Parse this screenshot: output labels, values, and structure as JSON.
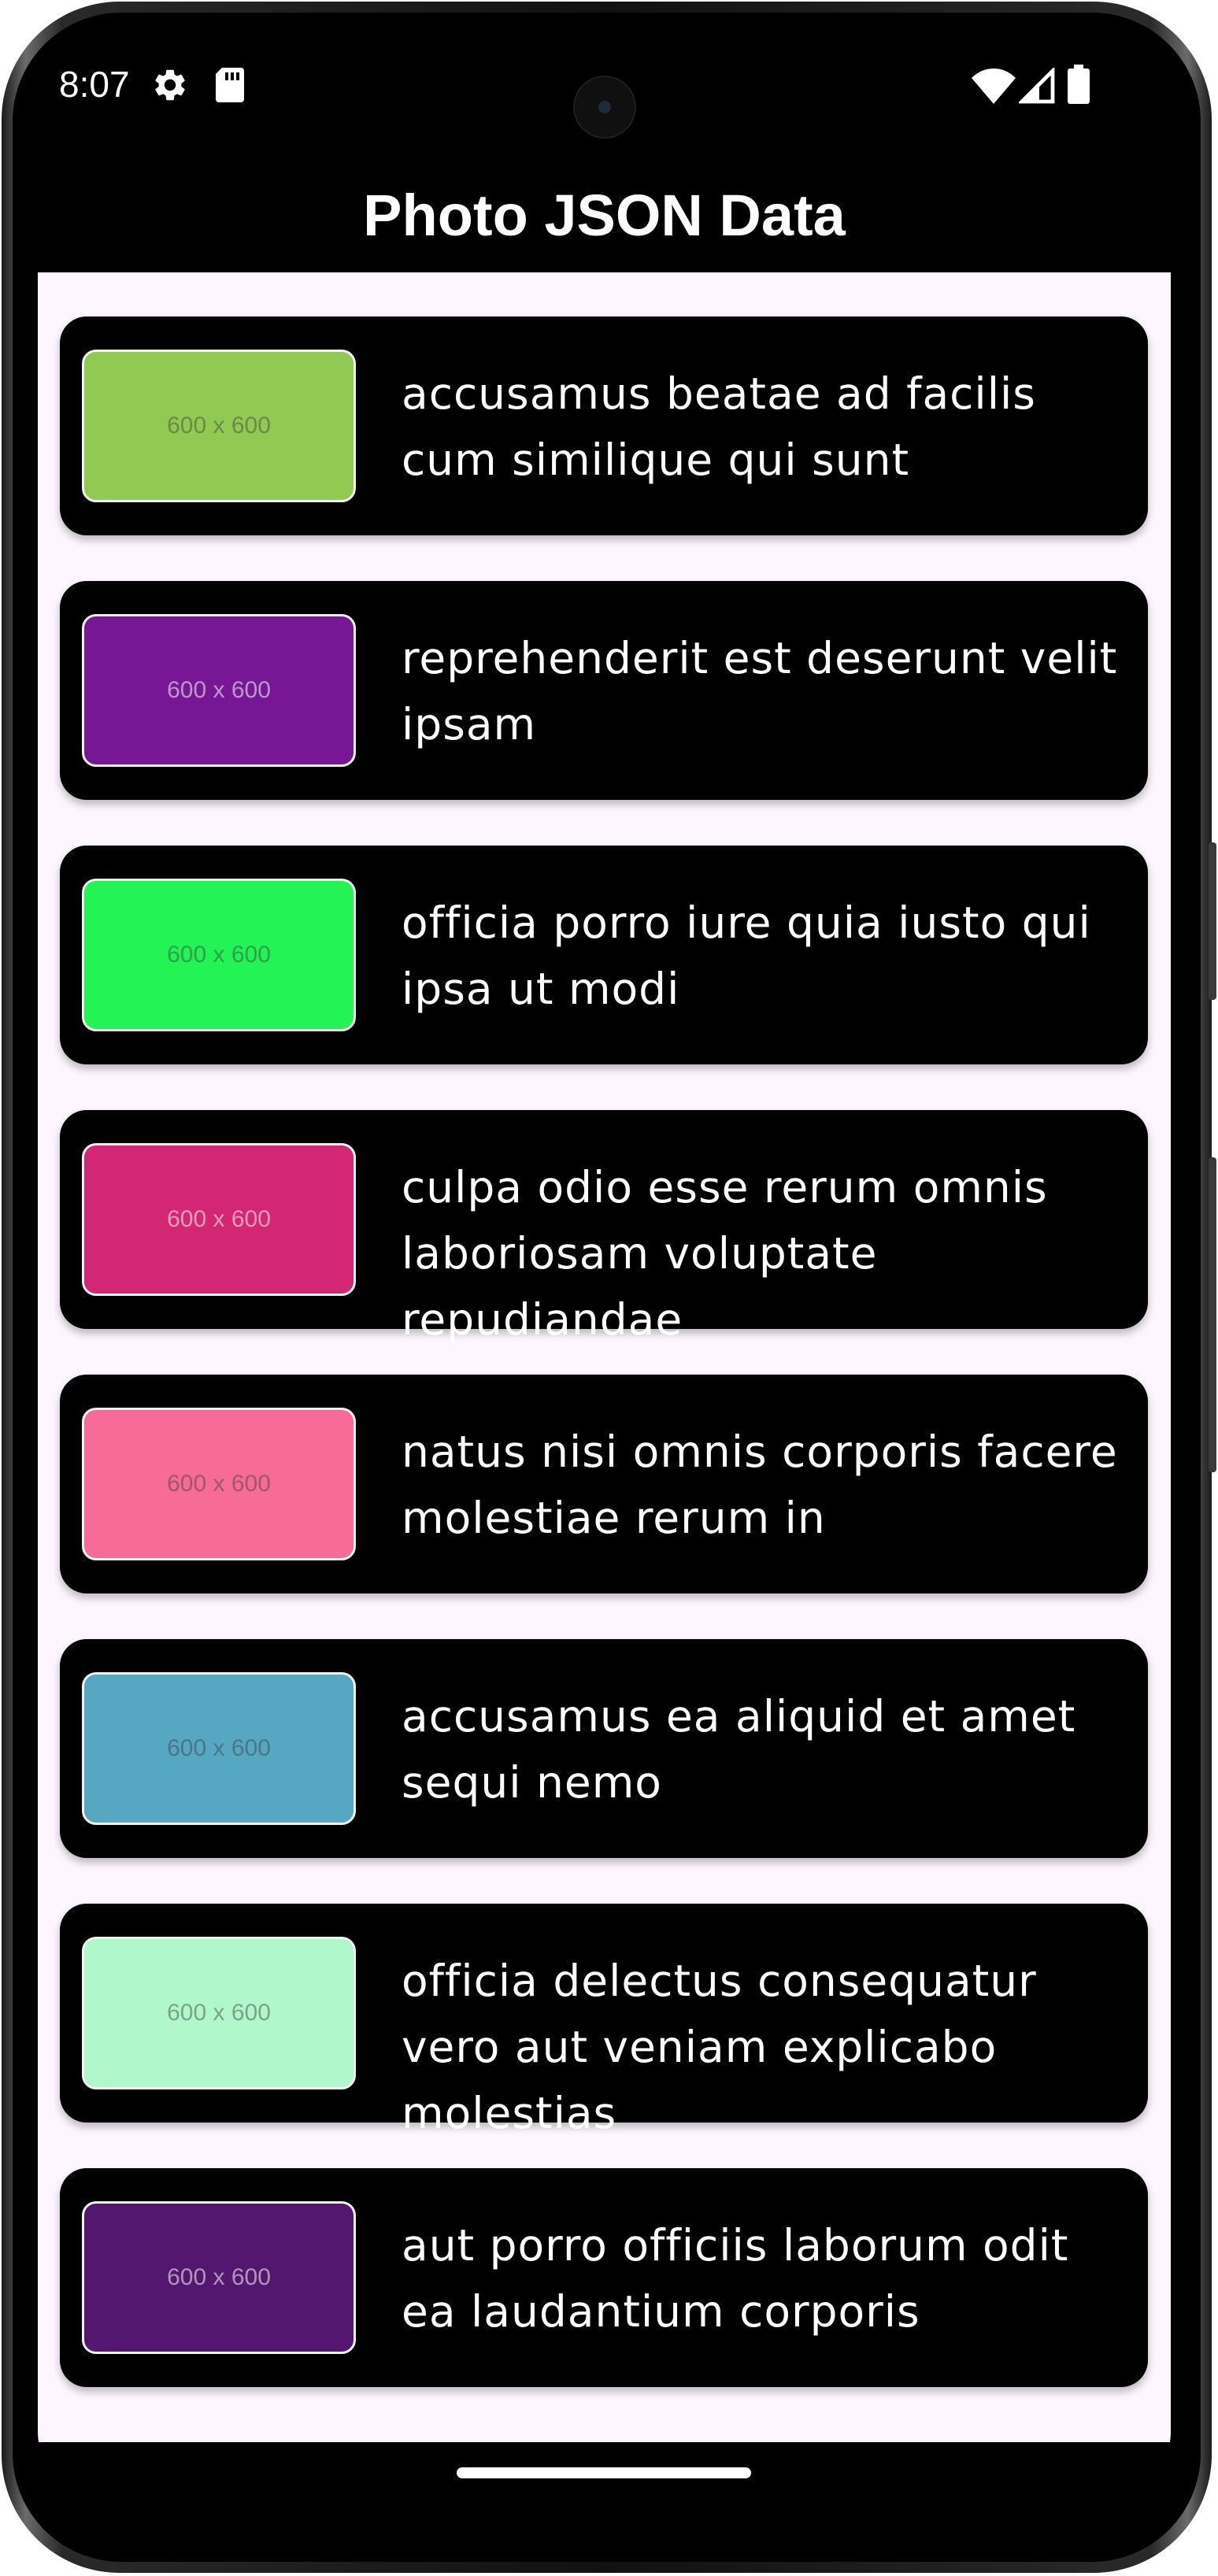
{
  "status_bar": {
    "time": "8:07",
    "left_icons": [
      "gear-icon",
      "sd-card-icon"
    ],
    "right_icons": [
      "wifi-icon",
      "cellular-signal-icon",
      "battery-icon"
    ]
  },
  "app_bar": {
    "title": "Photo JSON Data"
  },
  "photos": [
    {
      "title": "accusamus beatae ad facilis cum similique qui sunt",
      "thumbnail_label": "600 x 600",
      "color": "#92c952"
    },
    {
      "title": "reprehenderit est deserunt velit ipsam",
      "thumbnail_label": "600 x 600",
      "color": "#771796"
    },
    {
      "title": "officia porro iure quia iusto qui ipsa ut modi",
      "thumbnail_label": "600 x 600",
      "color": "#24f355"
    },
    {
      "title": "culpa odio esse rerum omnis laboriosam voluptate repudiandae",
      "thumbnail_label": "600 x 600",
      "color": "#d32776"
    },
    {
      "title": "natus nisi omnis corporis facere molestiae rerum in",
      "thumbnail_label": "600 x 600",
      "color": "#f66b97"
    },
    {
      "title": "accusamus ea aliquid et amet sequi nemo",
      "thumbnail_label": "600 x 600",
      "color": "#56a8c2"
    },
    {
      "title": "officia delectus consequatur vero aut veniam explicabo molestias",
      "thumbnail_label": "600 x 600",
      "color": "#b0f7cc"
    },
    {
      "title": "aut porro officiis laborum odit ea laudantium corporis",
      "thumbnail_label": "600 x 600",
      "color": "#54176f"
    }
  ],
  "colors": {
    "screen_background": "#fdf6fe",
    "card_background": "#000000",
    "app_bar_background": "#000000",
    "text": "#ffffff"
  }
}
